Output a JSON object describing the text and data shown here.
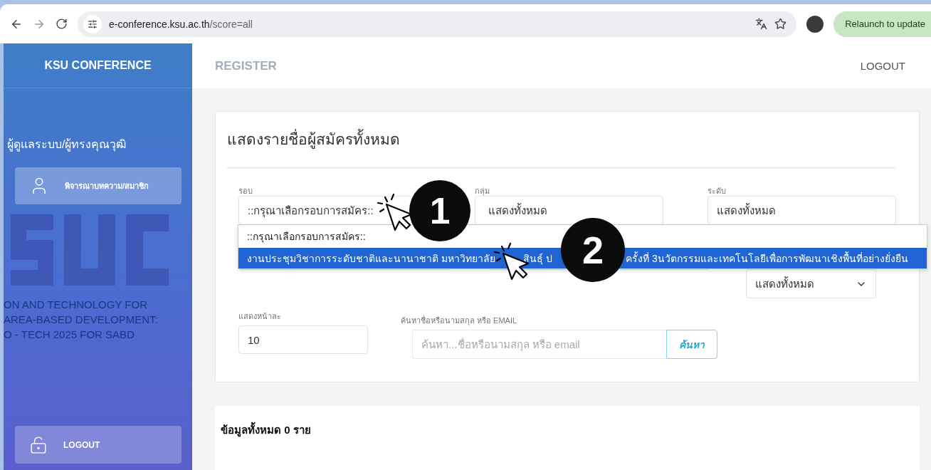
{
  "browser": {
    "url_host": "e-conference.ksu.ac.th",
    "url_path": "/score=all",
    "relaunch": "Relaunch to update"
  },
  "sidebar": {
    "brand": "KSU CONFERENCE",
    "role": "ผู้ดูแลระบบ/ผู้ทรงคุณวุฒิ",
    "items": [
      {
        "label": "พิจารณาบทความ/สมาชิก",
        "selected": true
      }
    ],
    "backdrop_lines": [
      "ON AND TECHNOLOGY FOR",
      "AREA-BASED DEVELOPMENT:",
      "O - TECH 2025 FOR SABD"
    ],
    "logout": "LOGOUT"
  },
  "header": {
    "faded_link": "REGISTER",
    "logout": "LOGOUT"
  },
  "card": {
    "title": "แสดงรายชื่อผู้สมัครทั้งหมด",
    "filters": [
      {
        "label": "รอบ",
        "value": "::กรุณาเลือกรอบการสมัคร::"
      },
      {
        "label": "กลุ่ม",
        "value": "แสดงทั้งหมด"
      },
      {
        "label": "ระดับ",
        "value": "แสดงทั้งหมด"
      }
    ],
    "second_row_value": "แสดงทั้งหมด",
    "per_page": {
      "label": "แสดงหน้าละ",
      "value": "10"
    },
    "search": {
      "label": "ค้นหาชื่อหรือนามสกุล หรือ EMAIL",
      "placeholder": "ค้นหา...ชื่อหรือนามสกุล หรือ email",
      "button": "ค้นหา"
    },
    "dropdown": [
      {
        "pieces": [
          "::กรุณาเลือกรอบการสมัคร::"
        ],
        "selected": false
      },
      {
        "pieces": [
          "งานประชุมวิชาการระดับชาติและนานาชาติ มหาวิทยาลัย",
          "สินธุ์ ป",
          "ครั้งที่ 3นวัตกรรมและเทคโนโลยีเพื่อการพัฒนาเชิงพื้นที่อย่างยั่งยืน"
        ],
        "selected": true
      }
    ]
  },
  "annotations": [
    {
      "number": "1"
    },
    {
      "number": "2"
    }
  ],
  "summary": "ข้อมูลทั้งหมด 0 ราย"
}
